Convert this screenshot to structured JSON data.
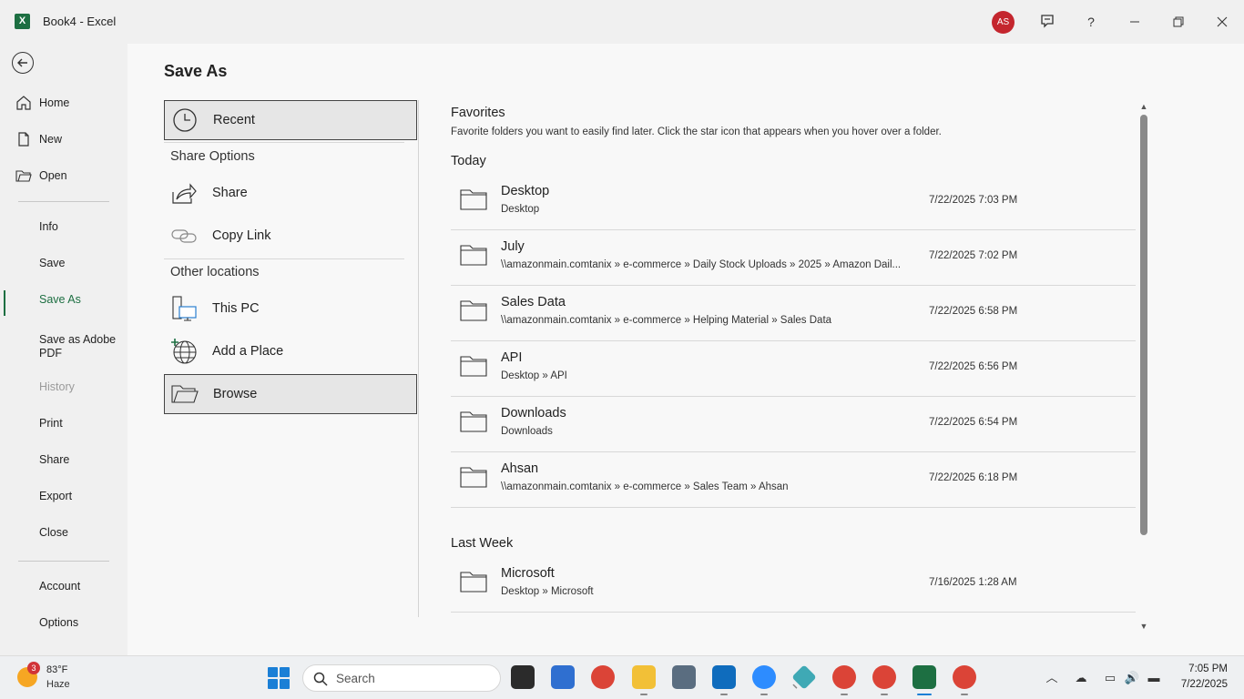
{
  "titlebar": {
    "app_icon_letter": "X",
    "document_title": "Book4  -  Excel",
    "user_initials": "AS"
  },
  "nav": {
    "items": [
      {
        "label": "Home",
        "icon": "home-icon"
      },
      {
        "label": "New",
        "icon": "new-document-icon"
      },
      {
        "label": "Open",
        "icon": "open-folder-icon"
      },
      {
        "label": "Info"
      },
      {
        "label": "Save"
      },
      {
        "label": "Save As",
        "selected": true
      },
      {
        "label": "Save as Adobe PDF"
      },
      {
        "label": "History",
        "disabled": true
      },
      {
        "label": "Print"
      },
      {
        "label": "Share"
      },
      {
        "label": "Export"
      },
      {
        "label": "Close"
      },
      {
        "label": "Account"
      },
      {
        "label": "Options"
      }
    ]
  },
  "main": {
    "page_title": "Save As",
    "locations": {
      "recent_label": "Recent",
      "share_options_heading": "Share Options",
      "share_label": "Share",
      "copy_link_label": "Copy Link",
      "other_locations_heading": "Other locations",
      "this_pc_label": "This PC",
      "add_place_label": "Add a Place",
      "browse_label": "Browse"
    },
    "recent": {
      "favorites_title": "Favorites",
      "favorites_desc": "Favorite folders you want to easily find later. Click the star icon that appears when you hover over a folder.",
      "today_title": "Today",
      "last_week_title": "Last Week",
      "today_folders": [
        {
          "name": "Desktop",
          "path": "Desktop",
          "date": "7/22/2025 7:03 PM"
        },
        {
          "name": "July",
          "path": "\\\\amazonmain.comtanix » e-commerce » Daily Stock Uploads » 2025 » Amazon Dail...",
          "date": "7/22/2025 7:02 PM"
        },
        {
          "name": "Sales Data",
          "path": "\\\\amazonmain.comtanix » e-commerce » Helping Material » Sales Data",
          "date": "7/22/2025 6:58 PM"
        },
        {
          "name": "API",
          "path": "Desktop » API",
          "date": "7/22/2025 6:56 PM"
        },
        {
          "name": "Downloads",
          "path": "Downloads",
          "date": "7/22/2025 6:54 PM"
        },
        {
          "name": "Ahsan",
          "path": "\\\\amazonmain.comtanix » e-commerce » Sales Team » Ahsan",
          "date": "7/22/2025 6:18 PM"
        }
      ],
      "last_week_folders": [
        {
          "name": "Microsoft",
          "path": "Desktop » Microsoft",
          "date": "7/16/2025 1:28 AM"
        }
      ]
    }
  },
  "taskbar": {
    "weather_badge": "3",
    "weather_temp": "83°F",
    "weather_condition": "Haze",
    "search_placeholder": "Search",
    "clock_time": "7:05 PM",
    "clock_date": "7/22/2025",
    "apps": [
      {
        "name": "task-view",
        "color": "#2b2b2b"
      },
      {
        "name": "microsoft-store",
        "color": "#2f6fd0"
      },
      {
        "name": "chrome",
        "color": "#db4437"
      },
      {
        "name": "file-explorer",
        "color": "#f2c037"
      },
      {
        "name": "calculator",
        "color": "#5a6d80"
      },
      {
        "name": "outlook",
        "color": "#0f6cbd"
      },
      {
        "name": "zoom",
        "color": "#2d8cff"
      },
      {
        "name": "app-diamond",
        "color": "#3fa9b5"
      },
      {
        "name": "chrome-profile-2",
        "color": "#db4437"
      },
      {
        "name": "chrome-profile-3",
        "color": "#db4437"
      },
      {
        "name": "excel",
        "color": "#1d6f42"
      },
      {
        "name": "chrome-profile-4",
        "color": "#db4437"
      }
    ]
  },
  "colors": {
    "excel_green": "#1d6f42",
    "avatar_red": "#c4262e",
    "windows_blue": "#1a7fd6"
  }
}
